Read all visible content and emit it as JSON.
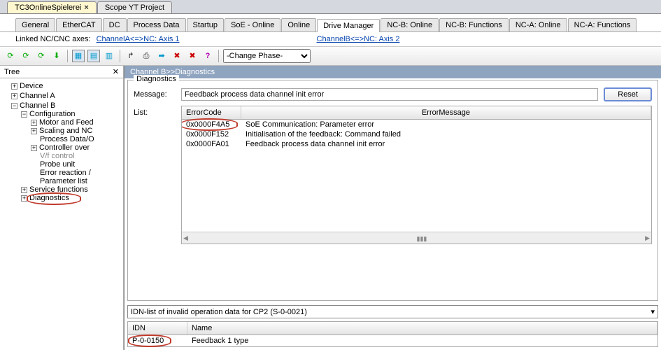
{
  "file_tabs": {
    "active": "TC3OnlineSpielerei",
    "other": "Scope YT Project"
  },
  "sub_tabs": [
    "General",
    "EtherCAT",
    "DC",
    "Process Data",
    "Startup",
    "SoE - Online",
    "Online",
    "Drive Manager",
    "NC-B: Online",
    "NC-B: Functions",
    "NC-A: Online",
    "NC-A: Functions"
  ],
  "sub_tab_active": 7,
  "linked_label": "Linked NC/CNC axes:",
  "link_a": "ChannelA<=>NC: Axis 1",
  "link_b": "ChannelB<=>NC: Axis 2",
  "phase_selected": "-Change Phase-",
  "tree": {
    "header": "Tree",
    "close_x": "✕",
    "items": {
      "device": "Device",
      "chA": "Channel A",
      "chB": "Channel B",
      "config": "Configuration",
      "motor": "Motor and Feed",
      "scaling": "Scaling and NC",
      "pdata": "Process Data/O",
      "ctrl": "Controller over",
      "vf": "V/f control",
      "probe": "Probe unit",
      "err": "Error reaction /",
      "param": "Parameter list",
      "svc": "Service functions",
      "diag": "Diagnostics"
    }
  },
  "channel_header": "Channel B>>Diagnostics",
  "diag": {
    "legend": "Diagnostics",
    "msg_label": "Message:",
    "msg_value": "Feedback process data channel init error",
    "reset": "Reset",
    "list_label": "List:",
    "col1": "ErrorCode",
    "col2": "ErrorMessage",
    "rows": [
      {
        "code": "0x0000F4A5",
        "msg": "SoE Communication: Parameter error"
      },
      {
        "code": "0x0000F152",
        "msg": "Initialisation of the feedback: Command failed"
      },
      {
        "code": "0x0000FA01",
        "msg": "Feedback process data channel init error"
      }
    ]
  },
  "idn": {
    "dropdown": "IDN-list of invalid operation data for CP2 (S-0-0021)",
    "col1": "IDN",
    "col2": "Name",
    "row_idn": "P-0-0150",
    "row_name": "Feedback 1 type"
  }
}
